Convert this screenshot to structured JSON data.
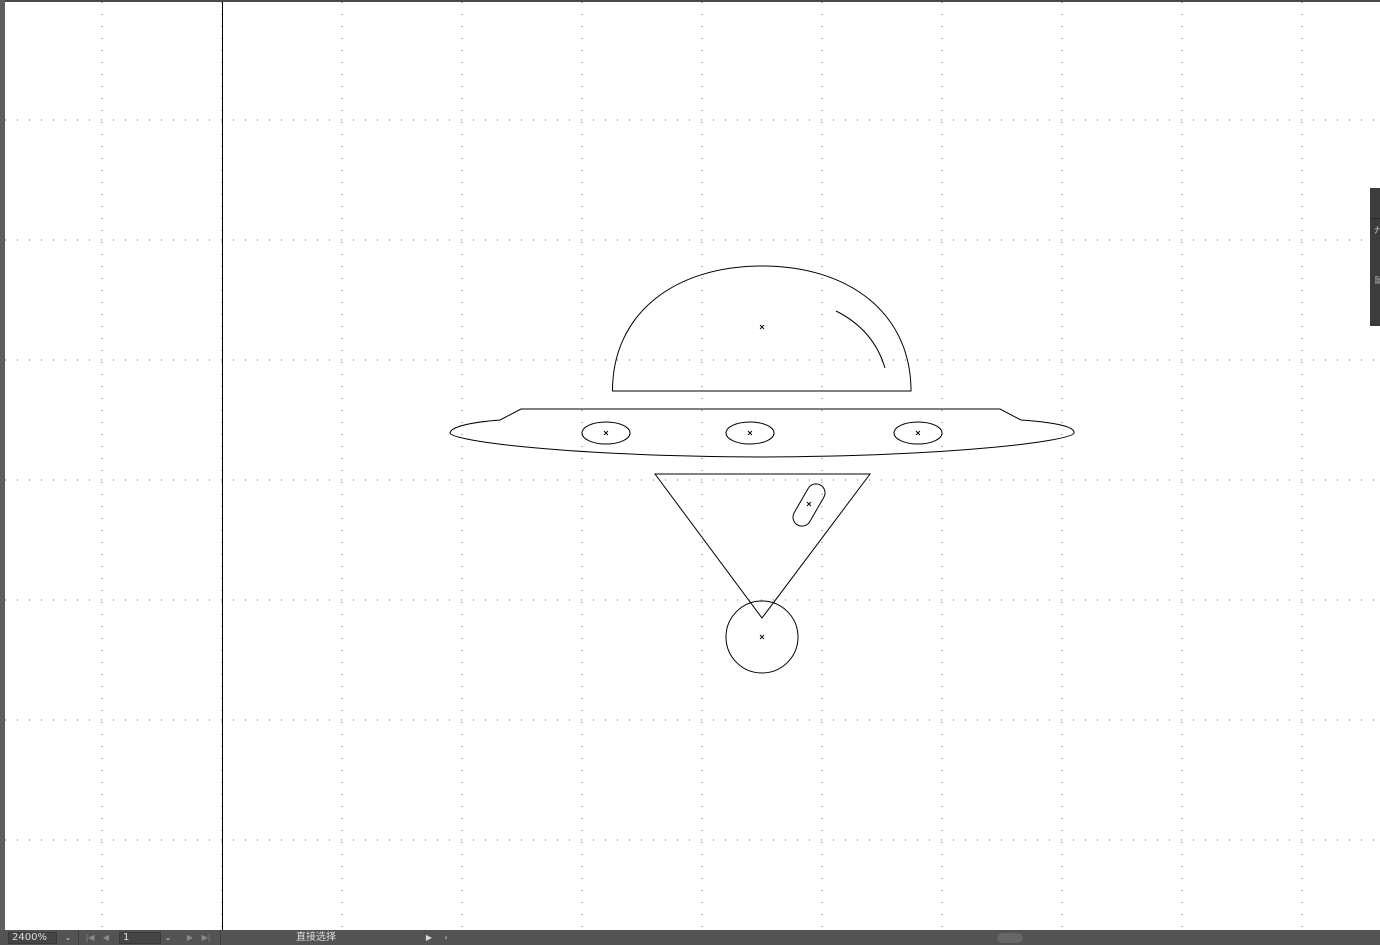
{
  "document": {
    "zoom": "2400%",
    "artboard_number": "1",
    "current_tool": "直接选择"
  },
  "canvas": {
    "grid": true,
    "background": "#ffffff",
    "stroke_color": "#000000",
    "grid_dot_color": "#6e6e6e"
  },
  "artwork": {
    "subject": "UFO outline",
    "shapes": [
      "dome",
      "dome-highlight",
      "saucer-body",
      "window-left",
      "window-center",
      "window-right",
      "beam-triangle",
      "beam-capsule",
      "beam-circle"
    ]
  },
  "status_bar": {
    "background": "#535353",
    "icons": {
      "zoom_dropdown": "chevron-down-icon",
      "first": "first-page-icon",
      "prev": "prev-page-icon",
      "artboard_dropdown": "chevron-down-icon",
      "next": "next-page-icon",
      "last": "last-page-icon",
      "tool_menu": "play-icon",
      "scroll_left": "chevron-left-icon"
    }
  },
  "side_panel": {
    "labels": [
      "开",
      "鼠"
    ]
  }
}
